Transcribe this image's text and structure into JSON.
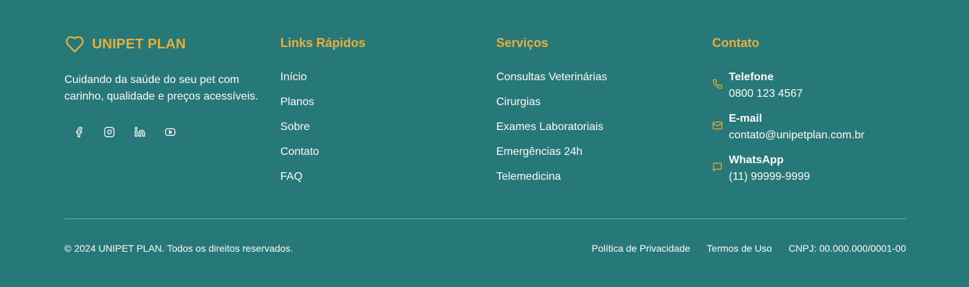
{
  "brand": {
    "name": "UNIPET PLAN",
    "tagline": "Cuidando da saúde do seu pet com carinho, qualidade e preços acessíveis.",
    "social": [
      "facebook-icon",
      "instagram-icon",
      "linkedin-icon",
      "youtube-icon"
    ]
  },
  "quick_links": {
    "title": "Links Rápidos",
    "items": [
      "Início",
      "Planos",
      "Sobre",
      "Contato",
      "FAQ"
    ]
  },
  "services": {
    "title": "Serviços",
    "items": [
      "Consultas Veterinárias",
      "Cirurgias",
      "Exames Laboratoriais",
      "Emergências 24h",
      "Telemedicina"
    ]
  },
  "contact": {
    "title": "Contato",
    "items": [
      {
        "label": "Telefone",
        "value": "0800 123 4567",
        "icon": "phone-icon"
      },
      {
        "label": "E-mail",
        "value": "contato@unipetplan.com.br",
        "icon": "mail-icon"
      },
      {
        "label": "WhatsApp",
        "value": "(11) 99999-9999",
        "icon": "chat-icon"
      }
    ]
  },
  "bottom": {
    "copyright": "© 2024 UNIPET PLAN. Todos os direitos reservados.",
    "privacy": "Política de Privacidade",
    "terms": "Termos de Uso",
    "cnpj": "CNPJ: 00.000.000/0001-00"
  },
  "colors": {
    "background": "#277878",
    "accent": "#e8ae3c",
    "divider": "#4fb6b4",
    "text": "#ffffff"
  }
}
